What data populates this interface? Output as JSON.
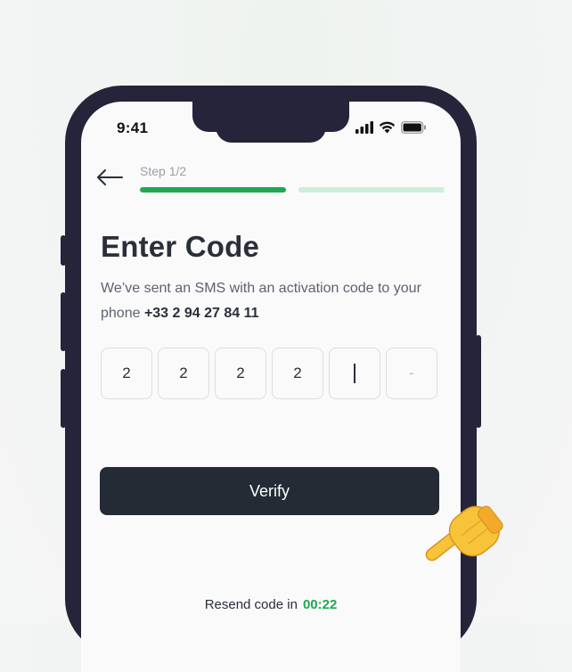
{
  "status_bar": {
    "time": "9:41",
    "icons": [
      "cellular-signal-icon",
      "wifi-icon",
      "battery-icon"
    ]
  },
  "header": {
    "back_icon": "arrow-left-icon",
    "step_label": "Step 1/2",
    "progress": {
      "total_steps": 2,
      "current_step": 1
    }
  },
  "main": {
    "title": "Enter Code",
    "subtitle_prefix": "We’ve sent an SMS with an activation code to your phone ",
    "phone_number": "+33 2 94 27 84 11",
    "code_digits": [
      "2",
      "2",
      "2",
      "2",
      "",
      "-"
    ],
    "verify_label": "Verify",
    "resend_label": "Resend code in",
    "resend_timer": "00:22"
  },
  "colors": {
    "accent_green": "#1fa84f",
    "progress_active": "#1fa84f",
    "progress_inactive": "#cdeedd",
    "button_dark": "#242b35",
    "phone_frame": "#25243a"
  },
  "overlay": {
    "cursor_icon": "pointing-hand-icon"
  }
}
